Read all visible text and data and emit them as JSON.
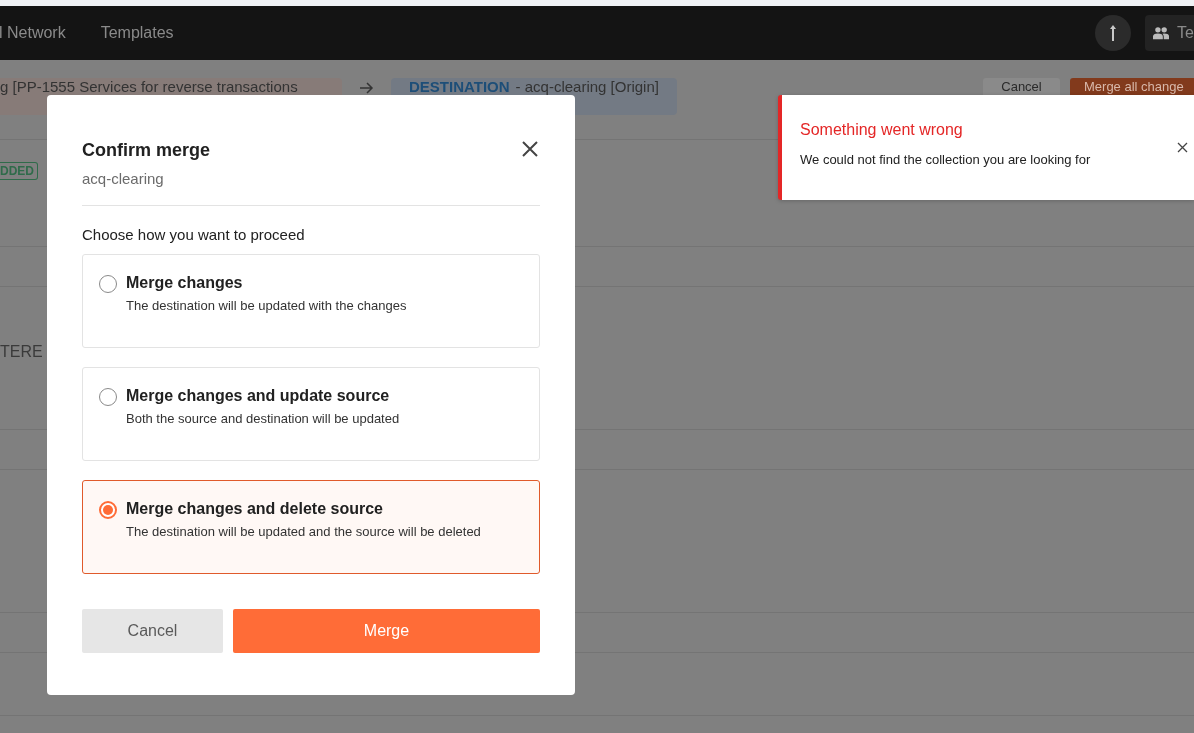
{
  "header": {
    "nav": [
      {
        "label": "l Network"
      },
      {
        "label": "Templates"
      }
    ],
    "team_button": {
      "label": "Te"
    }
  },
  "merge_bar": {
    "source": "g [PP-1555 Services for reverse transactions",
    "destination_label": "DESTINATION",
    "destination": "- acq-clearing [Origin]",
    "cancel": "Cancel",
    "merge_all": "Merge all change"
  },
  "list": {
    "badge": "DDED",
    "label": "TERE"
  },
  "dialog": {
    "title": "Confirm merge",
    "subtitle": "acq-clearing",
    "prompt": "Choose how you want to proceed",
    "options": [
      {
        "title": "Merge changes",
        "description": "The destination will be updated with the changes",
        "selected": false
      },
      {
        "title": "Merge changes and update source",
        "description": "Both the source and destination will be updated",
        "selected": false
      },
      {
        "title": "Merge changes and delete source",
        "description": "The destination will be updated and the source will be deleted",
        "selected": true
      }
    ],
    "cancel": "Cancel",
    "confirm": "Merge"
  },
  "toast": {
    "title": "Something went wrong",
    "message": "We could not find the collection you are looking for"
  }
}
